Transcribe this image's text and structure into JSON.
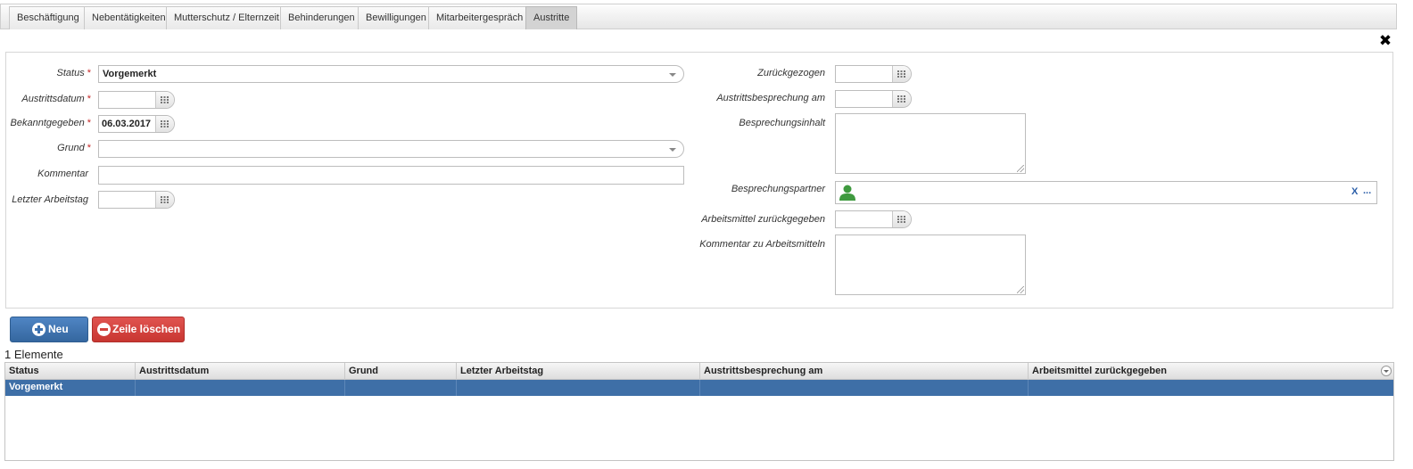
{
  "tabs": [
    {
      "label": "Beschäftigung"
    },
    {
      "label": "Nebentätigkeiten"
    },
    {
      "label": "Mutterschutz / Elternzeit"
    },
    {
      "label": "Behinderungen"
    },
    {
      "label": "Bewilligungen"
    },
    {
      "label": "Mitarbeitergespräch"
    },
    {
      "label": "Austritte",
      "active": true
    }
  ],
  "close_glyph": "✖",
  "form": {
    "required_marker": "*",
    "status_label": "Status",
    "status_value": "Vorgemerkt",
    "austrittsdatum_label": "Austrittsdatum",
    "austrittsdatum_value": "",
    "bekanntgegeben_label": "Bekanntgegeben",
    "bekanntgegeben_value": "06.03.2017",
    "grund_label": "Grund",
    "grund_value": "",
    "kommentar_label": "Kommentar",
    "kommentar_value": "",
    "letzter_arbeitstag_label": "Letzter Arbeitstag",
    "letzter_arbeitstag_value": "",
    "zurueckgezogen_label": "Zurückgezogen",
    "zurueckgezogen_value": "",
    "austrittsbesprechung_label": "Austrittsbesprechung am",
    "austrittsbesprechung_value": "",
    "besprechungsinhalt_label": "Besprechungsinhalt",
    "besprechungsinhalt_value": "",
    "besprechungspartner_label": "Besprechungspartner",
    "besprechungspartner_value": "",
    "partner_clear": "X",
    "partner_more": "...",
    "arbeitsmittel_label": "Arbeitsmittel zurückgegeben",
    "arbeitsmittel_value": "",
    "kommentar_arbeitsmittel_label": "Kommentar zu Arbeitsmitteln",
    "kommentar_arbeitsmittel_value": ""
  },
  "toolbar": {
    "new_label": "Neu",
    "delete_label": "Zeile löschen"
  },
  "grid": {
    "count_text": "1 Elemente",
    "columns": [
      "Status",
      "Austrittsdatum",
      "Grund",
      "Letzter Arbeitstag",
      "Austrittsbesprechung am",
      "Arbeitsmittel zurückgegeben"
    ],
    "rows": [
      [
        "Vorgemerkt",
        "",
        "",
        "",
        "",
        ""
      ]
    ]
  },
  "colors": {
    "primary_button": "#3d72b0",
    "danger_button": "#d2423d",
    "selected_row": "#3e6fa7",
    "required": "#c62828",
    "person_icon": "#3f9a3f"
  }
}
